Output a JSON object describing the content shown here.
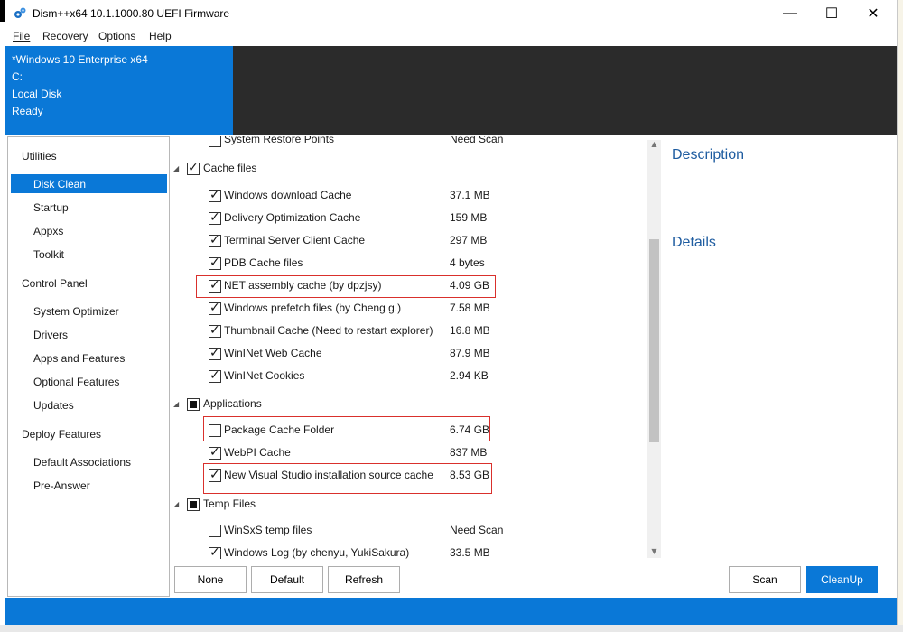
{
  "window": {
    "title": "Dism++x64 10.1.1000.80 UEFI Firmware",
    "minimize": "—",
    "maximize": "☐",
    "close": "✕"
  },
  "menu": [
    {
      "label": "File"
    },
    {
      "label": "Recovery"
    },
    {
      "label": "Options"
    },
    {
      "label": "Help"
    }
  ],
  "info": {
    "os": "*Windows 10 Enterprise x64",
    "drive": "C:",
    "disk": "Local Disk",
    "status": "Ready"
  },
  "sidebar": {
    "groups": [
      {
        "label": "Utilities",
        "items": [
          "Disk Clean",
          "Startup",
          "Appxs",
          "Toolkit"
        ]
      },
      {
        "label": "Control Panel",
        "items": [
          "System Optimizer",
          "Drivers",
          "Apps and Features",
          "Optional Features",
          "Updates"
        ]
      },
      {
        "label": "Deploy Features",
        "items": [
          "Default Associations",
          "Pre-Answer"
        ]
      }
    ],
    "selected": "Disk Clean"
  },
  "list": {
    "partial_top": {
      "label": "System Restore Points",
      "size": "Need Scan"
    },
    "categories": [
      {
        "label": "Cache files",
        "state": "checked",
        "items": [
          {
            "label": "Windows download Cache",
            "size": "37.1 MB",
            "checked": true
          },
          {
            "label": "Delivery Optimization Cache",
            "size": "159 MB",
            "checked": true
          },
          {
            "label": "Terminal Server Client Cache",
            "size": "297 MB",
            "checked": true
          },
          {
            "label": "PDB Cache files",
            "size": "4 bytes",
            "checked": true
          },
          {
            "label": "NET assembly cache (by dpzjsy)",
            "size": "4.09 GB",
            "checked": true,
            "highlight": true
          },
          {
            "label": "Windows prefetch files (by Cheng g.)",
            "size": "7.58 MB",
            "checked": true
          },
          {
            "label": "Thumbnail Cache (Need to restart explorer)",
            "size": "16.8 MB",
            "checked": true
          },
          {
            "label": "WinINet Web Cache",
            "size": "87.9 MB",
            "checked": true
          },
          {
            "label": "WinINet Cookies",
            "size": "2.94 KB",
            "checked": true
          }
        ]
      },
      {
        "label": "Applications",
        "state": "partial",
        "items": [
          {
            "label": "Package Cache Folder",
            "size": "6.74 GB",
            "checked": false,
            "highlight": true
          },
          {
            "label": "WebPI Cache",
            "size": "837 MB",
            "checked": true
          },
          {
            "label": "New Visual Studio installation source cache",
            "size": "8.53 GB",
            "checked": true,
            "highlight": true
          }
        ]
      },
      {
        "label": "Temp Files",
        "state": "partial",
        "items": [
          {
            "label": "WinSxS temp files",
            "size": "Need Scan",
            "checked": false
          },
          {
            "label": "Windows Log (by chenyu, YukiSakura)",
            "size": "33.5 MB",
            "checked": true
          }
        ]
      }
    ]
  },
  "panel": {
    "description_title": "Description",
    "details_title": "Details"
  },
  "buttons": {
    "none": "None",
    "default": "Default",
    "refresh": "Refresh",
    "scan": "Scan",
    "cleanup": "CleanUp"
  },
  "colors": {
    "accent": "#0a78d7",
    "dark_panel": "#2b2b2b",
    "highlight_border": "#d9302c",
    "heading": "#1e5ca0"
  }
}
